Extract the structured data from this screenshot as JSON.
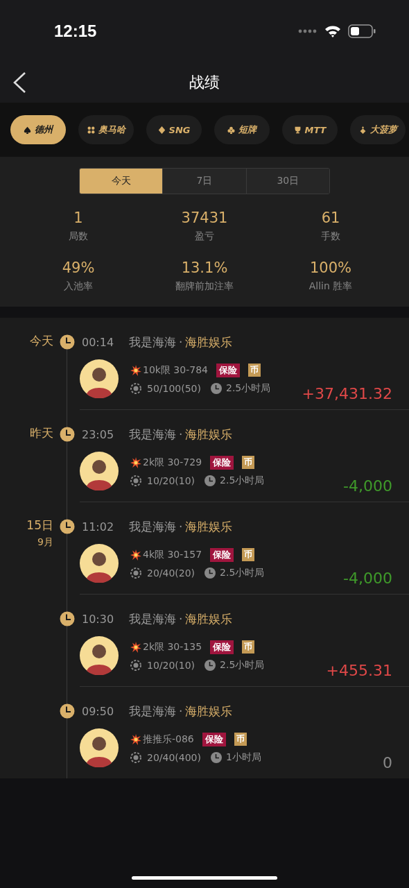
{
  "status_bar": {
    "time": "12:15"
  },
  "nav": {
    "title": "战绩"
  },
  "categories": [
    {
      "label": "德州",
      "selected": true
    },
    {
      "label": "奥马哈",
      "selected": false
    },
    {
      "label": "SNG",
      "selected": false
    },
    {
      "label": "短牌",
      "selected": false
    },
    {
      "label": "MTT",
      "selected": false
    },
    {
      "label": "大菠萝",
      "selected": false
    }
  ],
  "periods": [
    {
      "label": "今天",
      "selected": true
    },
    {
      "label": "7日",
      "selected": false
    },
    {
      "label": "30日",
      "selected": false
    }
  ],
  "stats": [
    {
      "value": "1",
      "label": "局数"
    },
    {
      "value": "37431",
      "label": "盈亏"
    },
    {
      "value": "61",
      "label": "手数"
    },
    {
      "value": "49%",
      "label": "入池率"
    },
    {
      "value": "13.1%",
      "label": "翻牌前加注率"
    },
    {
      "value": "100%",
      "label": "Allin 胜率"
    }
  ],
  "records": [
    {
      "day": "今天",
      "time": "00:14",
      "player": "我是海海",
      "separator": "·",
      "club": "海胜娱乐",
      "game": "10k限 30-784",
      "insurance": "保险",
      "coin": "币",
      "blinds": "50/100(50)",
      "duration": "2.5小时局",
      "result": "+37,431.32",
      "kind": "win"
    },
    {
      "day": "昨天",
      "time": "23:05",
      "player": "我是海海",
      "separator": "·",
      "club": "海胜娱乐",
      "game": "2k限 30-729",
      "insurance": "保险",
      "coin": "币",
      "blinds": "10/20(10)",
      "duration": "2.5小时局",
      "result": "-4,000",
      "kind": "loss"
    },
    {
      "day": "15日",
      "month": "9月",
      "time": "11:02",
      "player": "我是海海",
      "separator": "·",
      "club": "海胜娱乐",
      "game": "4k限 30-157",
      "insurance": "保险",
      "coin": "币",
      "blinds": "20/40(20)",
      "duration": "2.5小时局",
      "result": "-4,000",
      "kind": "loss"
    },
    {
      "time": "10:30",
      "player": "我是海海",
      "separator": "·",
      "club": "海胜娱乐",
      "game": "2k限 30-135",
      "insurance": "保险",
      "coin": "币",
      "blinds": "10/20(10)",
      "duration": "2.5小时局",
      "result": "+455.31",
      "kind": "win"
    },
    {
      "time": "09:50",
      "player": "我是海海",
      "separator": "·",
      "club": "海胜娱乐",
      "game": "推推乐-086",
      "insurance": "保险",
      "coin": "币",
      "blinds": "20/40(400)",
      "duration": "1小时局",
      "result": "0",
      "kind": "even"
    }
  ]
}
